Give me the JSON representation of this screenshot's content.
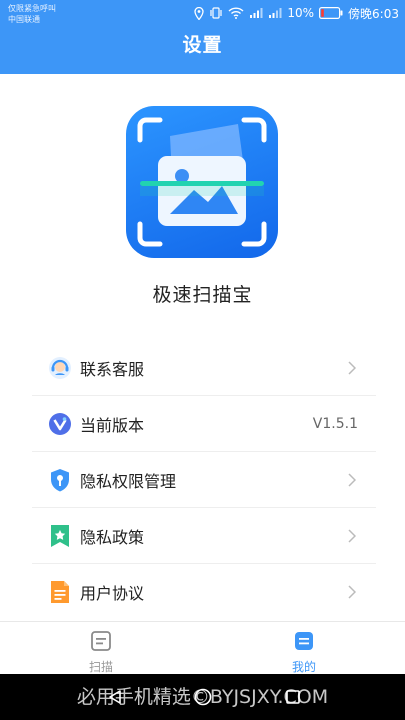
{
  "status_bar": {
    "line1": "仅限紧急呼叫",
    "line2": "中国联通",
    "battery": "10%",
    "time": "傍晚6:03"
  },
  "header": {
    "title": "设置"
  },
  "app": {
    "name": "极速扫描宝"
  },
  "menu": [
    {
      "label": "联系客服",
      "icon": "customer-service-icon",
      "value": ""
    },
    {
      "label": "当前版本",
      "icon": "version-icon",
      "value": "V1.5.1"
    },
    {
      "label": "隐私权限管理",
      "icon": "shield-icon",
      "value": ""
    },
    {
      "label": "隐私政策",
      "icon": "bookmark-star-icon",
      "value": ""
    },
    {
      "label": "用户协议",
      "icon": "document-icon",
      "value": ""
    }
  ],
  "tabbar": {
    "tabs": [
      {
        "label": "扫描",
        "icon": "scan-document-icon",
        "active": false
      },
      {
        "label": "我的",
        "icon": "profile-icon",
        "active": true
      }
    ]
  },
  "watermark": "必用手机精选©BYJSJXY.COM",
  "colors": {
    "primary": "#3d96f7",
    "text": "#222222",
    "muted": "#999999",
    "background": "#ffffff"
  }
}
